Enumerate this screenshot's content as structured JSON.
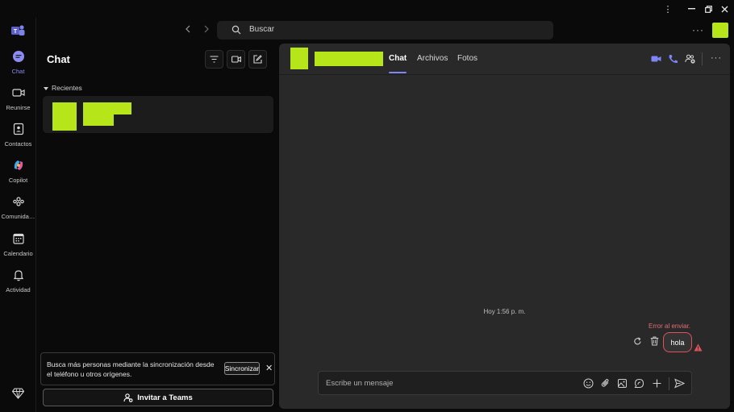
{
  "titlebar": {
    "more": "⋮",
    "minimize": "—",
    "restore": "❐",
    "close": "✕"
  },
  "rail": {
    "items": [
      {
        "label": "Chat",
        "icon": "chat-icon",
        "active": true
      },
      {
        "label": "Reunirse",
        "icon": "video-icon"
      },
      {
        "label": "Contactos",
        "icon": "contacts-icon"
      },
      {
        "label": "Copilot",
        "icon": "copilot-icon"
      },
      {
        "label": "Comunida…",
        "icon": "communities-icon"
      },
      {
        "label": "Calendario",
        "icon": "calendar-icon"
      },
      {
        "label": "Actividad",
        "icon": "bell-icon"
      }
    ]
  },
  "search": {
    "placeholder": "Buscar"
  },
  "top": {
    "more": "···"
  },
  "left": {
    "title": "Chat",
    "recent_header": "Recientes",
    "sync_text": "Busca más personas mediante la sincronización desde el teléfono u otros orígenes.",
    "sync_button": "Sincronizar",
    "sync_close": "✕",
    "invite_button": "Invitar a Teams"
  },
  "conversation": {
    "tabs": [
      {
        "label": "Chat",
        "active": true
      },
      {
        "label": "Archivos"
      },
      {
        "label": "Fotos"
      }
    ],
    "more": "···",
    "timestamp": "Hoy 1:56 p. m.",
    "error_text": "Error al enviar.",
    "message": "hola",
    "composer_placeholder": "Escribe un mensaje"
  },
  "colors": {
    "accent": "#7f85f5",
    "redaction": "#b6e61a",
    "error": "#e0525a",
    "panel": "#292929"
  }
}
